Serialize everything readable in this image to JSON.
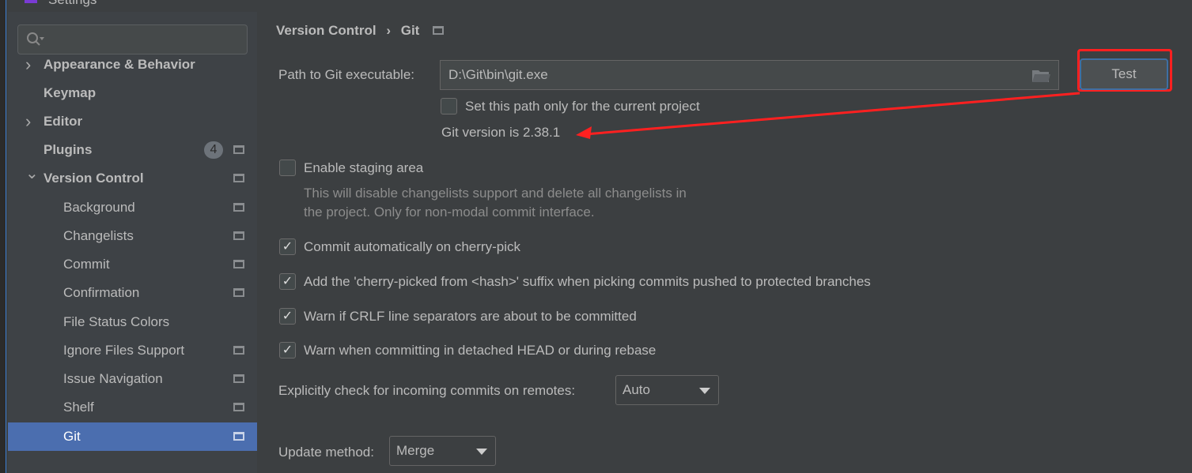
{
  "window": {
    "title": "Settings"
  },
  "sidebar": {
    "search_placeholder": "",
    "items": [
      {
        "label": "Appearance & Behavior",
        "expandable": true,
        "expanded": false
      },
      {
        "label": "Keymap"
      },
      {
        "label": "Editor",
        "expandable": true,
        "expanded": false
      },
      {
        "label": "Plugins",
        "badge": "4"
      },
      {
        "label": "Version Control",
        "expandable": true,
        "expanded": true
      },
      {
        "label": "Background"
      },
      {
        "label": "Changelists"
      },
      {
        "label": "Commit"
      },
      {
        "label": "Confirmation"
      },
      {
        "label": "File Status Colors"
      },
      {
        "label": "Ignore Files Support"
      },
      {
        "label": "Issue Navigation"
      },
      {
        "label": "Shelf"
      },
      {
        "label": "Git",
        "selected": true
      }
    ]
  },
  "main": {
    "breadcrumb": [
      "Version Control",
      "Git"
    ],
    "path_label": "Path to Git executable:",
    "path_value": "D:\\Git\\bin\\git.exe",
    "test_label": "Test",
    "current_project_only": {
      "label": "Set this path only for the current project",
      "checked": false
    },
    "git_version": "Git version is 2.38.1",
    "staging": {
      "label": "Enable staging area",
      "checked": false,
      "description": [
        "This will disable changelists support and delete all changelists in",
        "the project. Only for non-modal commit interface."
      ]
    },
    "options": [
      {
        "label": "Commit automatically on cherry-pick",
        "checked": true
      },
      {
        "label": "Add the 'cherry-picked from <hash>' suffix when picking commits pushed to protected branches",
        "checked": true
      },
      {
        "label": "Warn if CRLF line separators are about to be committed",
        "checked": true
      },
      {
        "label": "Warn when committing in detached HEAD or during rebase",
        "checked": true
      }
    ],
    "incoming_label": "Explicitly check for incoming commits on remotes:",
    "incoming_value": "Auto",
    "update_label": "Update method:",
    "update_value": "Merge"
  },
  "colors": {
    "selection": "#4b6eaf",
    "annotation": "#ff2020"
  }
}
